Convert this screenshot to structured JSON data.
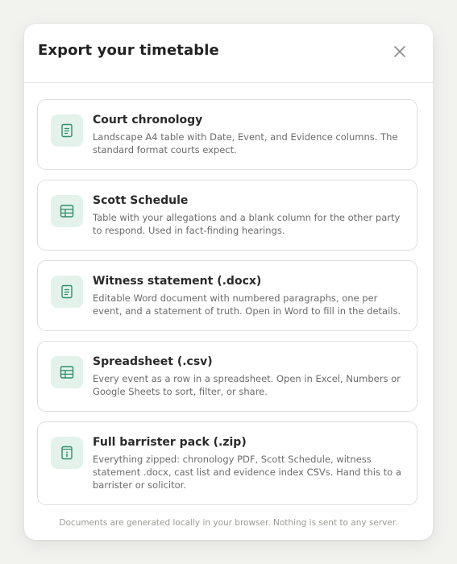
{
  "modal": {
    "title": "Export your timetable",
    "close_icon": "close-icon"
  },
  "options": [
    {
      "icon": "document-icon",
      "title": "Court chronology",
      "description": "Landscape A4 table with Date, Event, and Evidence columns. The standard format courts expect."
    },
    {
      "icon": "table-icon",
      "title": "Scott Schedule",
      "description": "Table with your allegations and a blank column for the other party to respond. Used in fact-finding hearings."
    },
    {
      "icon": "document-icon",
      "title": "Witness statement (.docx)",
      "description": "Editable Word document with numbered paragraphs, one per event, and a statement of truth. Open in Word to fill in the details."
    },
    {
      "icon": "table-icon",
      "title": "Spreadsheet (.csv)",
      "description": "Every event as a row in a spreadsheet. Open in Excel, Numbers or Google Sheets to sort, filter, or share."
    },
    {
      "icon": "archive-icon",
      "title": "Full barrister pack (.zip)",
      "description": "Everything zipped: chronology PDF, Scott Schedule, witness statement .docx, cast list and evidence index CSVs. Hand this to a barrister or solicitor."
    }
  ],
  "footer": {
    "note": "Documents are generated locally in your browser. Nothing is sent to any server."
  },
  "colors": {
    "accent": "#2f8f6b",
    "icon_bg": "#e4f2ec"
  }
}
